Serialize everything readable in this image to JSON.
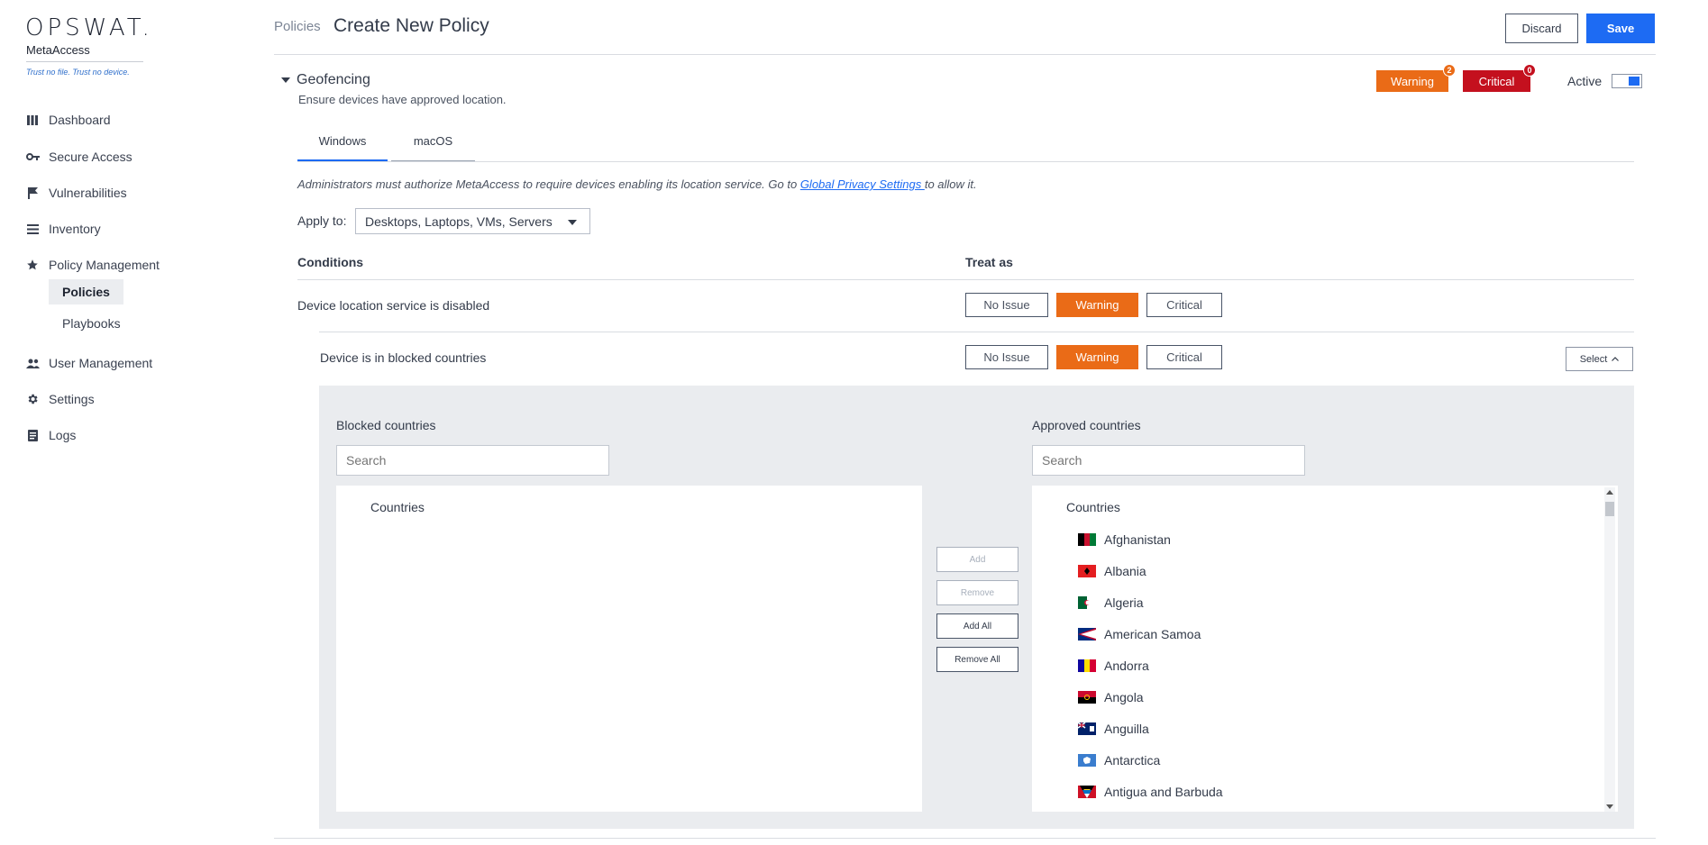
{
  "sidebar": {
    "logo_word": "OPSWAT.",
    "product": "MetaAccess",
    "tagline": "Trust no file. Trust no device.",
    "items": [
      {
        "label": "Dashboard",
        "icon": "bar-chart-icon"
      },
      {
        "label": "Secure Access",
        "icon": "key-icon"
      },
      {
        "label": "Vulnerabilities",
        "icon": "flag-icon"
      },
      {
        "label": "Inventory",
        "icon": "list-icon"
      },
      {
        "label": "Policy Management",
        "icon": "star-icon"
      },
      {
        "label": "User Management",
        "icon": "users-icon"
      },
      {
        "label": "Settings",
        "icon": "gear-icon"
      },
      {
        "label": "Logs",
        "icon": "document-icon"
      }
    ],
    "sub_items": [
      {
        "label": "Policies",
        "active": true
      },
      {
        "label": "Playbooks",
        "active": false
      }
    ]
  },
  "header": {
    "breadcrumb": "Policies",
    "title": "Create New Policy",
    "discard_label": "Discard",
    "save_label": "Save"
  },
  "section": {
    "title": "Geofencing",
    "subtitle": "Ensure devices have approved location.",
    "warning_label": "Warning",
    "warning_count": "2",
    "critical_label": "Critical",
    "critical_count": "0",
    "active_label": "Active",
    "active": true
  },
  "tabs": [
    {
      "label": "Windows",
      "active": true
    },
    {
      "label": "macOS",
      "active": false
    }
  ],
  "note": {
    "text_before": "Administrators must authorize MetaAccess to require devices enabling its location service. Go to ",
    "link": "Global Privacy Settings ",
    "text_after": "to allow it."
  },
  "apply_to": {
    "label": "Apply to:",
    "value": "Desktops, Laptops, VMs, Servers"
  },
  "conditions": {
    "col_conditions": "Conditions",
    "col_treat_as": "Treat as",
    "rows": [
      {
        "label": "Device location service is disabled",
        "options": [
          "No Issue",
          "Warning",
          "Critical"
        ],
        "selected": "Warning"
      },
      {
        "label": "Device is in blocked countries",
        "options": [
          "No Issue",
          "Warning",
          "Critical"
        ],
        "selected": "Warning"
      }
    ],
    "select_label": "Select"
  },
  "blocked": {
    "label": "Blocked countries",
    "search_placeholder": "Search",
    "list_header": "Countries"
  },
  "approved": {
    "label": "Approved countries",
    "search_placeholder": "Search",
    "list_header": "Countries",
    "countries": [
      "Afghanistan",
      "Albania",
      "Algeria",
      "American Samoa",
      "Andorra",
      "Angola",
      "Anguilla",
      "Antarctica",
      "Antigua and Barbuda"
    ]
  },
  "transfer_buttons": {
    "add": "Add",
    "remove": "Remove",
    "add_all": "Add All",
    "remove_all": "Remove All"
  },
  "colors": {
    "accent": "#1d6bf3",
    "warning": "#ea6b17",
    "critical": "#c4101e"
  }
}
